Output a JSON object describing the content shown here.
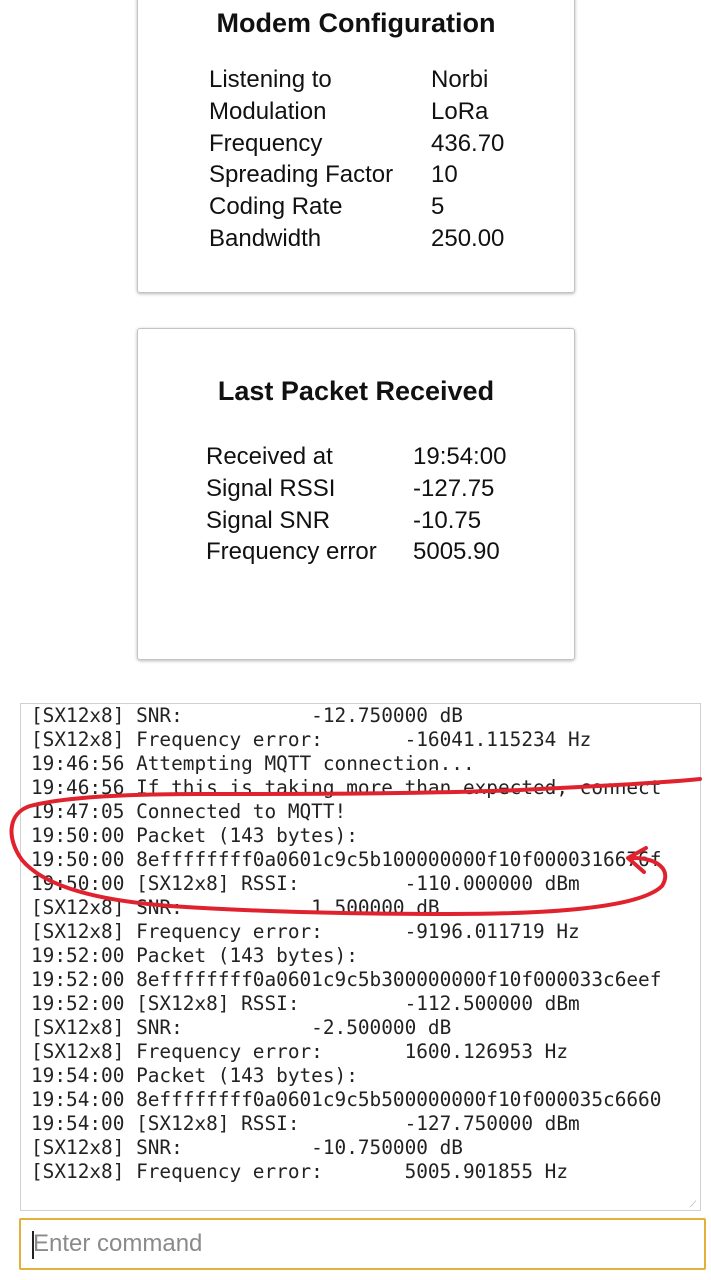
{
  "modem": {
    "title": "Modem Configuration",
    "rows": [
      {
        "key": "Listening to",
        "value": "Norbi"
      },
      {
        "key": "Modulation",
        "value": "LoRa"
      },
      {
        "key": "Frequency",
        "value": "436.70"
      },
      {
        "key": "Spreading Factor",
        "value": "10"
      },
      {
        "key": "Coding Rate",
        "value": "5"
      },
      {
        "key": "Bandwidth",
        "value": "250.00"
      }
    ]
  },
  "packet": {
    "title": "Last Packet Received",
    "rows": [
      {
        "key": "Received at",
        "value": "19:54:00"
      },
      {
        "key": "Signal RSSI",
        "value": "-127.75"
      },
      {
        "key": "Signal SNR",
        "value": "-10.75"
      },
      {
        "key": "Frequency error",
        "value": "5005.90"
      }
    ]
  },
  "console": {
    "lines": [
      "[SX12x8] SNR:           -12.750000 dB",
      "[SX12x8] Frequency error:       -16041.115234 Hz",
      "19:46:56 Attempting MQTT connection...",
      "19:46:56 If this is taking more than expected, connect",
      "19:47:05 Connected to MQTT!",
      "19:50:00 Packet (143 bytes):",
      "19:50:00 8effffffff0a0601c9c5b100000000f10f0000316676f",
      "19:50:00 [SX12x8] RSSI:         -110.000000 dBm",
      "[SX12x8] SNR:           1.500000 dB",
      "[SX12x8] Frequency error:       -9196.011719 Hz",
      "19:52:00 Packet (143 bytes):",
      "19:52:00 8effffffff0a0601c9c5b300000000f10f000033c6eef",
      "19:52:00 [SX12x8] RSSI:         -112.500000 dBm",
      "[SX12x8] SNR:           -2.500000 dB",
      "[SX12x8] Frequency error:       1600.126953 Hz",
      "19:54:00 Packet (143 bytes):",
      "19:54:00 8effffffff0a0601c9c5b500000000f10f000035c6660",
      "19:54:00 [SX12x8] RSSI:         -127.750000 dBm",
      "[SX12x8] SNR:           -10.750000 dB",
      "[SX12x8] Frequency error:       5005.901855 Hz"
    ]
  },
  "command": {
    "placeholder": "Enter command",
    "value": ""
  },
  "annotation": {
    "color": "#e0222e"
  }
}
